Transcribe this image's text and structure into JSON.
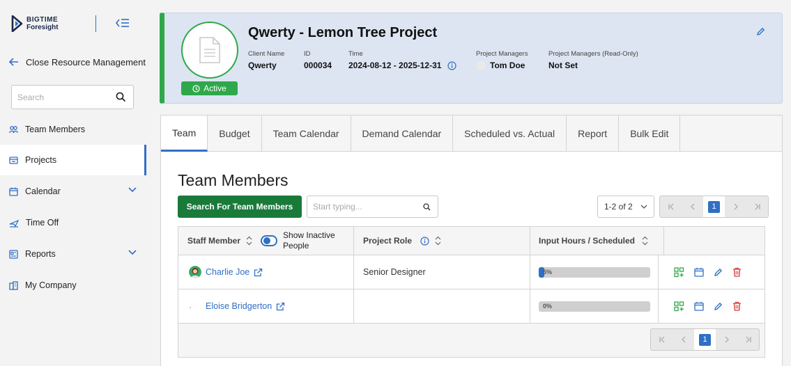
{
  "brand": {
    "line1": "BIGTIME",
    "line2": "Foresight",
    "accent": "#2f6fc4"
  },
  "sidebar": {
    "back_label": "Close Resource Management",
    "search_placeholder": "Search",
    "items": [
      {
        "label": "Team Members",
        "icon": "people-icon"
      },
      {
        "label": "Projects",
        "icon": "folder-icon",
        "active": true
      },
      {
        "label": "Calendar",
        "icon": "calendar-icon",
        "expandable": true
      },
      {
        "label": "Time Off",
        "icon": "plane-icon"
      },
      {
        "label": "Reports",
        "icon": "report-icon",
        "expandable": true
      },
      {
        "label": "My Company",
        "icon": "building-icon"
      }
    ]
  },
  "project": {
    "title": "Qwerty - Lemon Tree Project",
    "status": "Active",
    "status_color": "#2ea84a",
    "meta": [
      {
        "key": "Client Name",
        "value": "Qwerty"
      },
      {
        "key": "ID",
        "value": "000034"
      },
      {
        "key": "Time",
        "value": "2024-08-12 - 2025-12-31"
      },
      {
        "key": "Project Managers",
        "value": "Tom Doe"
      },
      {
        "key": "Project Managers (Read-Only)",
        "value": "Not Set"
      }
    ]
  },
  "tabs": [
    "Team",
    "Budget",
    "Team Calendar",
    "Demand Calendar",
    "Scheduled vs. Actual",
    "Report",
    "Bulk Edit"
  ],
  "team": {
    "title": "Team Members",
    "search_button": "Search For Team Members",
    "search_placeholder": "Start typing...",
    "page_range": "1-2 of 2",
    "current_page": "1",
    "columns": {
      "staff": "Staff Member",
      "show_inactive": "Show Inactive People",
      "role": "Project Role",
      "hours": "Input Hours / Scheduled"
    },
    "rows": [
      {
        "name": "Charlie Joe",
        "role": "Senior Designer",
        "progress_label": "5%",
        "progress": 0.05
      },
      {
        "name": "Eloise Bridgerton",
        "role": "",
        "progress_label": "0%",
        "progress": 0
      }
    ]
  }
}
